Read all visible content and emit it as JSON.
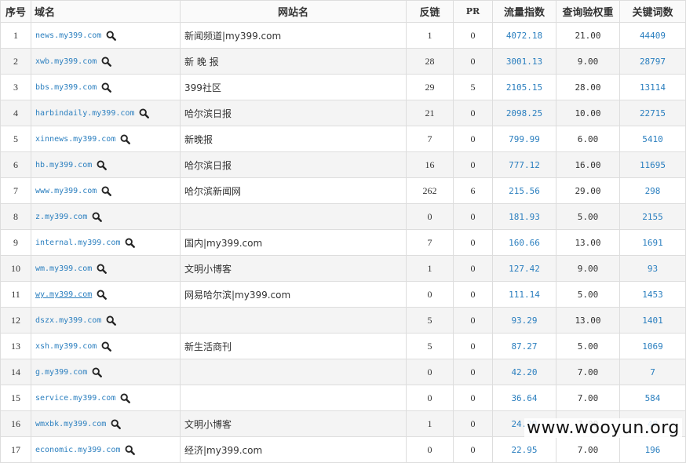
{
  "headers": [
    "序号",
    "域名",
    "网站名",
    "反链",
    "PR",
    "流量指数",
    "查询验权重",
    "关键词数"
  ],
  "rows": [
    {
      "id": "1",
      "domain": "news.my399.com",
      "site": "新闻频道|my399.com",
      "backlinks": "1",
      "pr": "0",
      "traffic": "4072.18",
      "weight": "21.00",
      "keywords": "44409"
    },
    {
      "id": "2",
      "domain": "xwb.my399.com",
      "site": "新 晚 报",
      "backlinks": "28",
      "pr": "0",
      "traffic": "3001.13",
      "weight": "9.00",
      "keywords": "28797"
    },
    {
      "id": "3",
      "domain": "bbs.my399.com",
      "site": "399社区",
      "backlinks": "29",
      "pr": "5",
      "traffic": "2105.15",
      "weight": "28.00",
      "keywords": "13114"
    },
    {
      "id": "4",
      "domain": "harbindaily.my399.com",
      "site": "哈尔滨日报",
      "backlinks": "21",
      "pr": "0",
      "traffic": "2098.25",
      "weight": "10.00",
      "keywords": "22715"
    },
    {
      "id": "5",
      "domain": "xinnews.my399.com",
      "site": "新晚报",
      "backlinks": "7",
      "pr": "0",
      "traffic": "799.99",
      "weight": "6.00",
      "keywords": "5410"
    },
    {
      "id": "6",
      "domain": "hb.my399.com",
      "site": "哈尔滨日报",
      "backlinks": "16",
      "pr": "0",
      "traffic": "777.12",
      "weight": "16.00",
      "keywords": "11695"
    },
    {
      "id": "7",
      "domain": "www.my399.com",
      "site": "哈尔滨新闻网",
      "backlinks": "262",
      "pr": "6",
      "traffic": "215.56",
      "weight": "29.00",
      "keywords": "298"
    },
    {
      "id": "8",
      "domain": "z.my399.com",
      "site": "",
      "backlinks": "0",
      "pr": "0",
      "traffic": "181.93",
      "weight": "5.00",
      "keywords": "2155"
    },
    {
      "id": "9",
      "domain": "internal.my399.com",
      "site": "国内|my399.com",
      "backlinks": "7",
      "pr": "0",
      "traffic": "160.66",
      "weight": "13.00",
      "keywords": "1691"
    },
    {
      "id": "10",
      "domain": "wm.my399.com",
      "site": "文明小博客",
      "backlinks": "1",
      "pr": "0",
      "traffic": "127.42",
      "weight": "9.00",
      "keywords": "93"
    },
    {
      "id": "11",
      "domain": "wy.my399.com",
      "site": "网易哈尔滨|my399.com",
      "backlinks": "0",
      "pr": "0",
      "traffic": "111.14",
      "weight": "5.00",
      "keywords": "1453",
      "underline": true
    },
    {
      "id": "12",
      "domain": "dszx.my399.com",
      "site": "",
      "backlinks": "5",
      "pr": "0",
      "traffic": "93.29",
      "weight": "13.00",
      "keywords": "1401"
    },
    {
      "id": "13",
      "domain": "xsh.my399.com",
      "site": "新生活商刊",
      "backlinks": "5",
      "pr": "0",
      "traffic": "87.27",
      "weight": "5.00",
      "keywords": "1069"
    },
    {
      "id": "14",
      "domain": "g.my399.com",
      "site": "",
      "backlinks": "0",
      "pr": "0",
      "traffic": "42.20",
      "weight": "7.00",
      "keywords": "7"
    },
    {
      "id": "15",
      "domain": "service.my399.com",
      "site": "",
      "backlinks": "0",
      "pr": "0",
      "traffic": "36.64",
      "weight": "7.00",
      "keywords": "584"
    },
    {
      "id": "16",
      "domain": "wmxbk.my399.com",
      "site": "文明小博客",
      "backlinks": "1",
      "pr": "0",
      "traffic": "24.29",
      "weight": "7.00",
      "keywords": "40"
    },
    {
      "id": "17",
      "domain": "economic.my399.com",
      "site": "经济|my399.com",
      "backlinks": "0",
      "pr": "0",
      "traffic": "22.95",
      "weight": "7.00",
      "keywords": "196"
    }
  ],
  "icons": {
    "row_action": "magnifier-icon"
  },
  "colors": {
    "link": "#2b7fbf",
    "row_alt": "#f4f4f4",
    "border": "#dddddd"
  },
  "watermark": "www.wooyun.org"
}
